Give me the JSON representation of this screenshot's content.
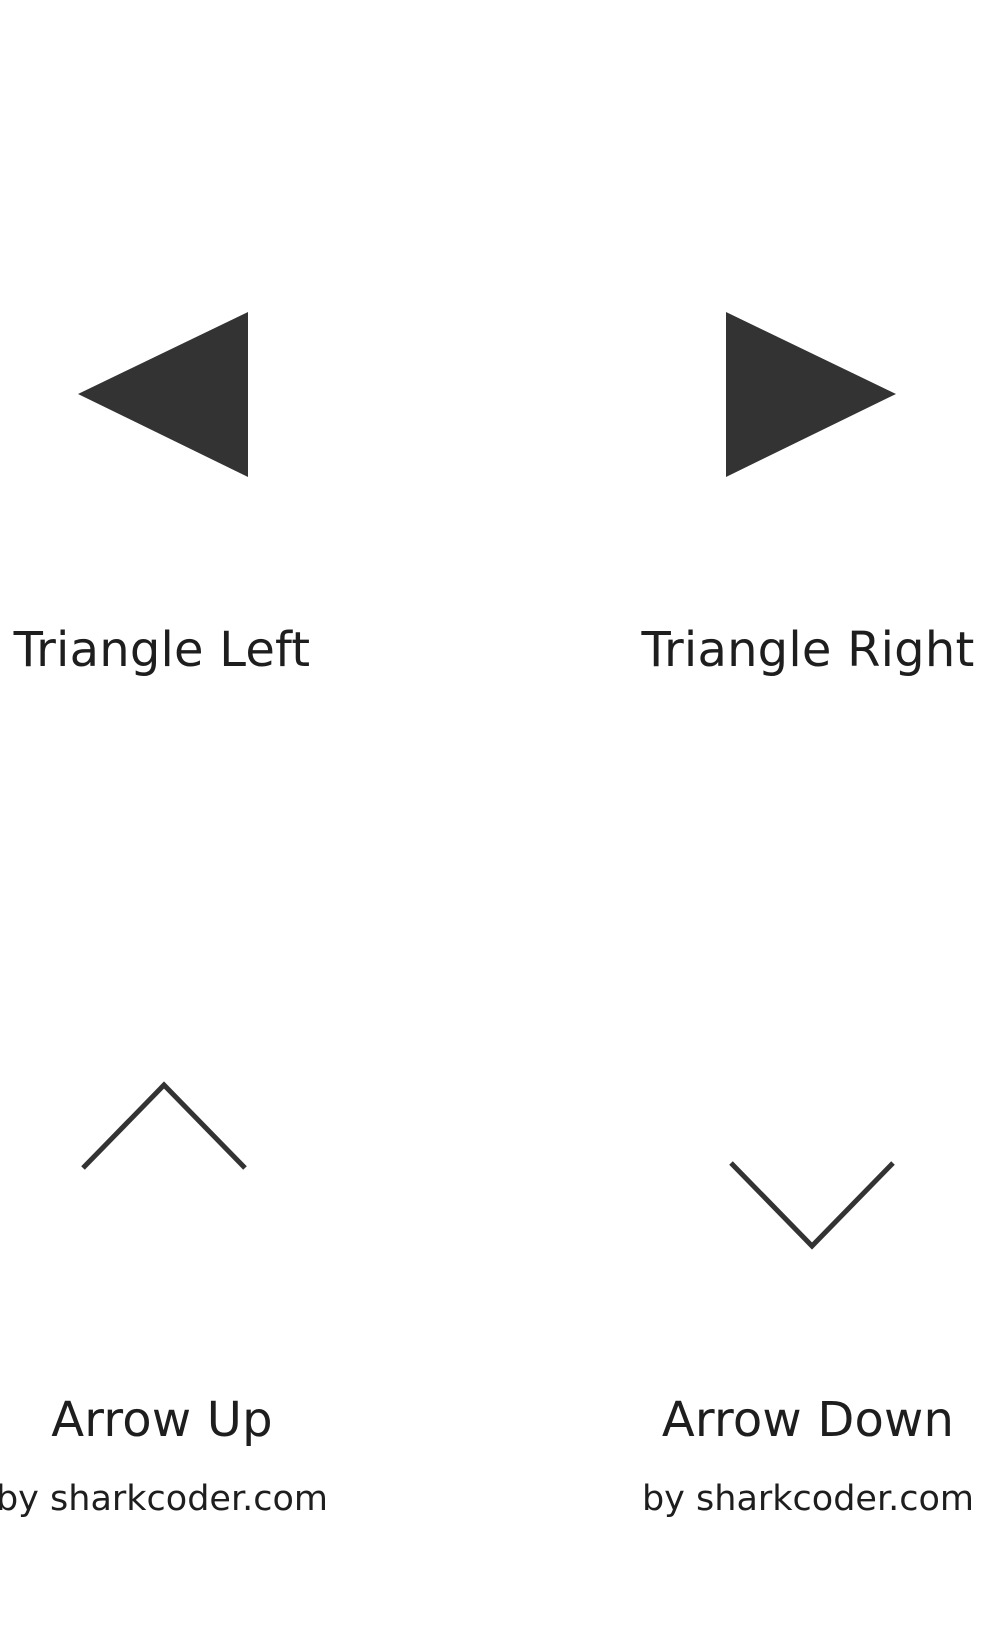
{
  "colors": {
    "shape": "#333333",
    "text": "#1e1e1e",
    "background": "#ffffff"
  },
  "items": [
    {
      "label": "Triangle Left",
      "icon": "triangle-left-icon"
    },
    {
      "label": "Triangle Right",
      "icon": "triangle-right-icon"
    },
    {
      "label": "Arrow Up",
      "icon": "arrow-up-icon",
      "credit": "by sharkcoder.com"
    },
    {
      "label": "Arrow Down",
      "icon": "arrow-down-icon",
      "credit": "by sharkcoder.com"
    }
  ]
}
